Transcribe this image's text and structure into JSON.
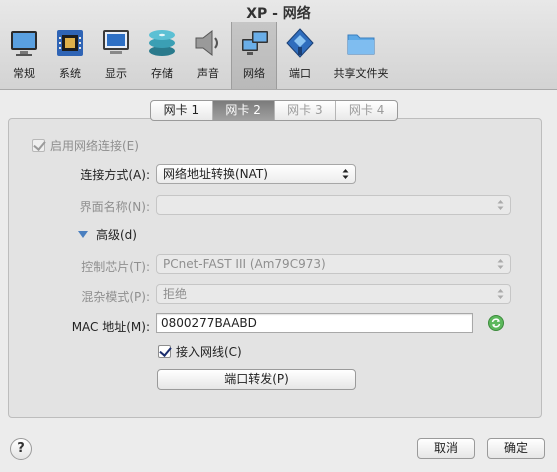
{
  "window": {
    "title": "XP - 网络"
  },
  "toolbar": {
    "items": [
      {
        "label": "常规",
        "icon": "monitor-general-icon"
      },
      {
        "label": "系统",
        "icon": "chip-system-icon"
      },
      {
        "label": "显示",
        "icon": "display-icon"
      },
      {
        "label": "存储",
        "icon": "disks-storage-icon"
      },
      {
        "label": "声音",
        "icon": "speaker-icon"
      },
      {
        "label": "网络",
        "icon": "network-icon",
        "selected": true
      },
      {
        "label": "端口",
        "icon": "serial-port-icon"
      },
      {
        "label": "共享文件夹",
        "icon": "folder-icon"
      }
    ]
  },
  "tabs": [
    {
      "label": "网卡 1",
      "state": "normal"
    },
    {
      "label": "网卡 2",
      "state": "selected"
    },
    {
      "label": "网卡 3",
      "state": "disabled"
    },
    {
      "label": "网卡 4",
      "state": "disabled"
    }
  ],
  "form": {
    "enable_label": "启用网络连接(E)",
    "enable_checked": true,
    "attach_label": "连接方式(A):",
    "attach_value": "网络地址转换(NAT)",
    "name_label": "界面名称(N):",
    "name_value": "",
    "advanced_label": "高级(d)",
    "adapter_label": "控制芯片(T):",
    "adapter_value": "PCnet-FAST III (Am79C973)",
    "promisc_label": "混杂模式(P):",
    "promisc_value": "拒绝",
    "mac_label": "MAC 地址(M):",
    "mac_value": "0800277BAABD",
    "cable_label": "接入网线(C)",
    "cable_checked": true,
    "port_forward_label": "端口转发(P)"
  },
  "footer": {
    "help_label": "?",
    "cancel_label": "取消",
    "ok_label": "确定"
  },
  "colors": {
    "accent": "#4a7fbf",
    "selected_tab": "#8a8a8a",
    "refresh_icon": "#4caf50"
  }
}
